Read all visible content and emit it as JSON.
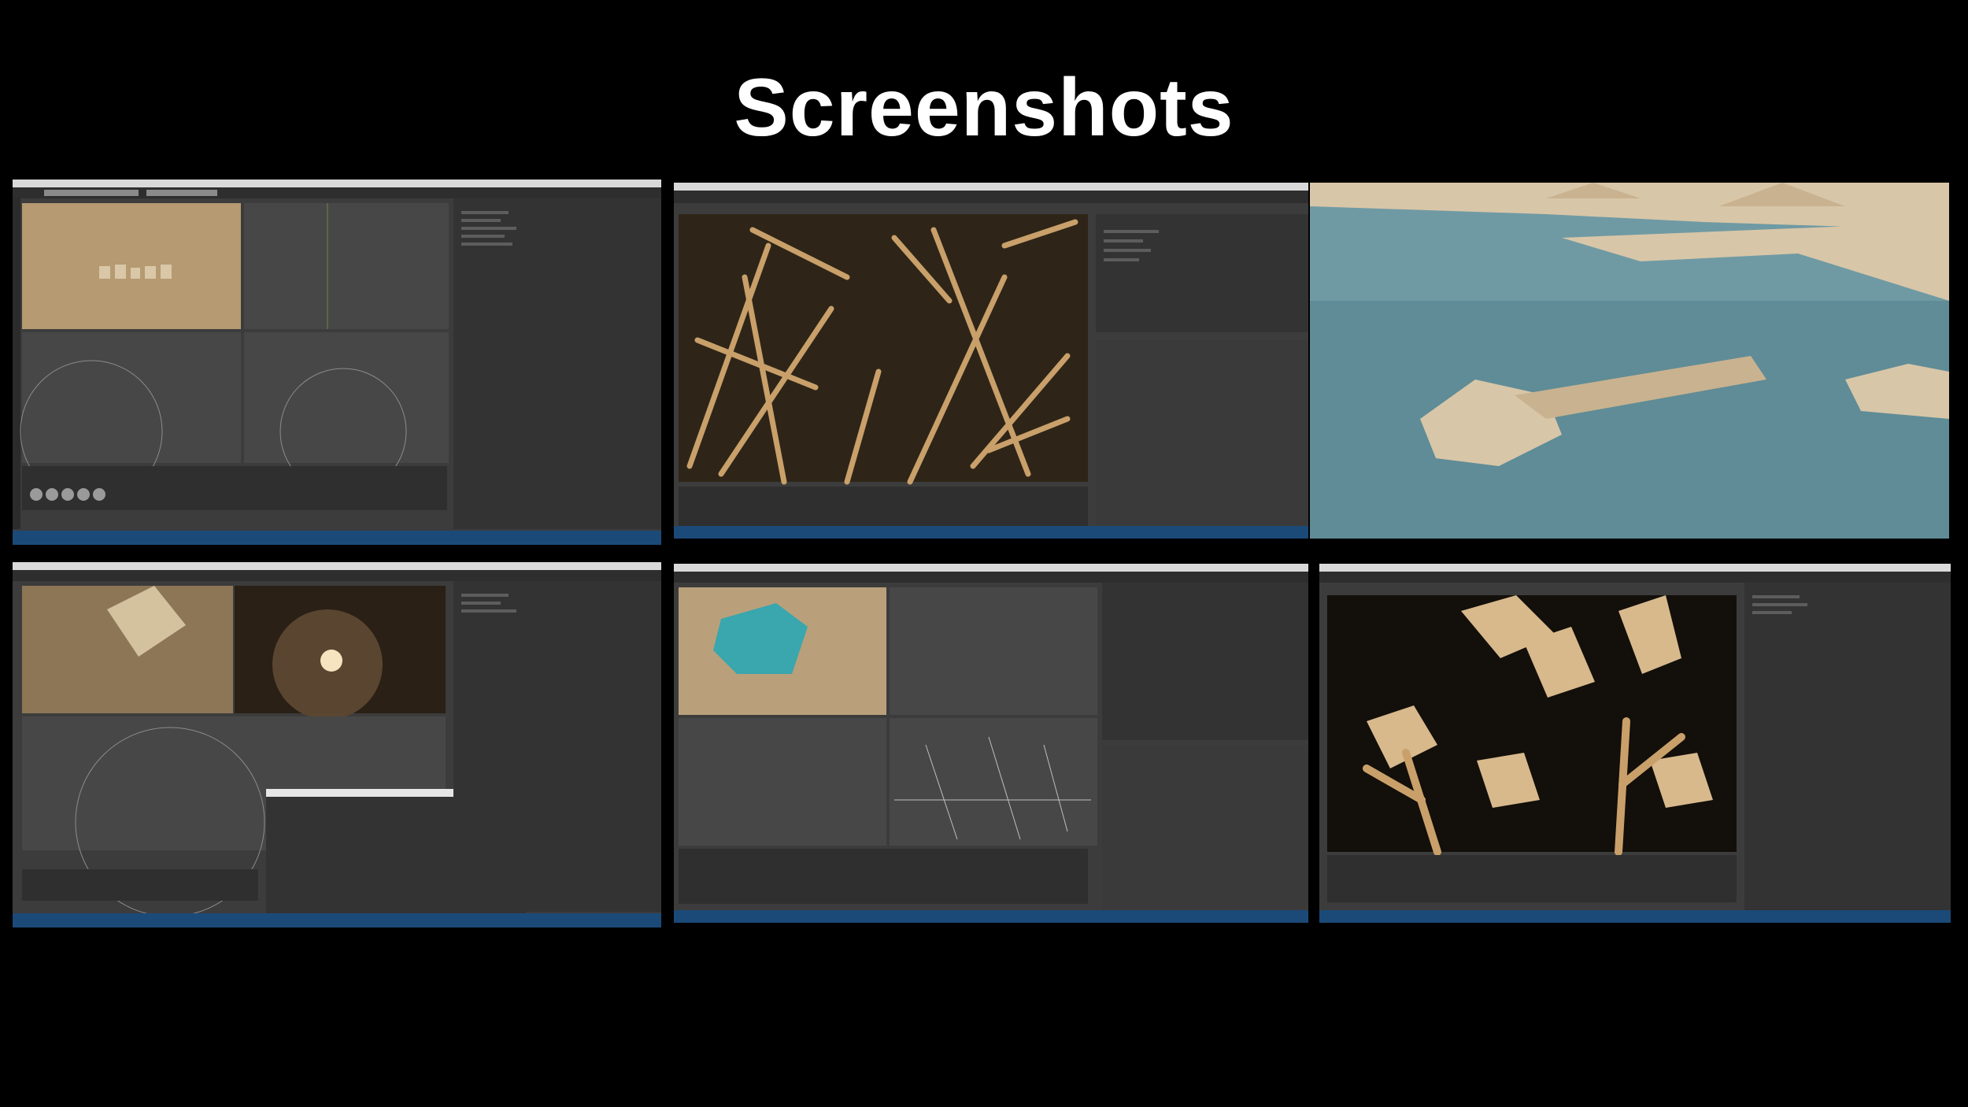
{
  "page": {
    "title": "Screenshots"
  },
  "screenshots": [
    {
      "id": "shot-1",
      "kind": "cinema4d-ui"
    },
    {
      "id": "shot-2",
      "kind": "cinema4d-ui"
    },
    {
      "id": "shot-3",
      "kind": "render"
    },
    {
      "id": "shot-4",
      "kind": "cinema4d-ui"
    },
    {
      "id": "shot-5",
      "kind": "cinema4d-ui"
    },
    {
      "id": "shot-6",
      "kind": "cinema4d-ui"
    }
  ],
  "colors": {
    "background": "#000000",
    "title": "#ffffff",
    "ui_panel": "#3c3c3c",
    "ui_dark": "#2b2b2b",
    "menubar": "#d9d9d9",
    "sepia": "#b59a72",
    "wood": "#c9a06a",
    "water": "#6f9aa3",
    "sand": "#d8c6a8"
  }
}
